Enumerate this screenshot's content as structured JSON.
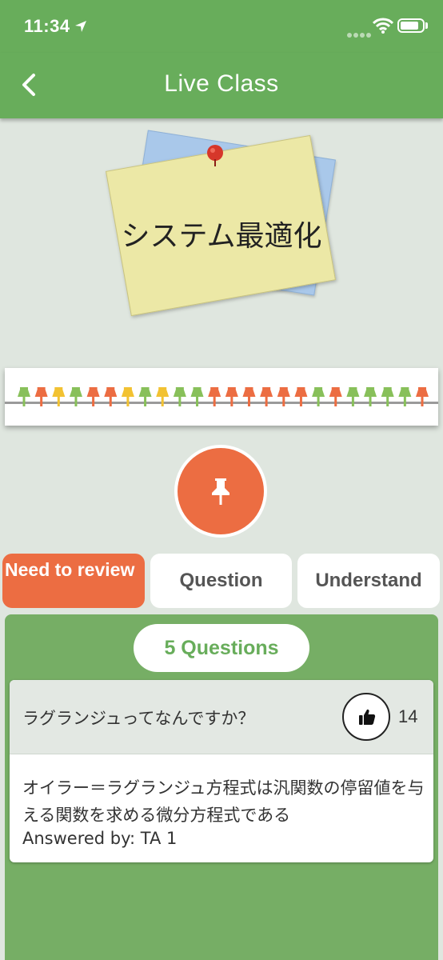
{
  "status_bar": {
    "time": "11:34",
    "icons": [
      "location-arrow-icon",
      "cellular-signal-icon",
      "wifi-icon",
      "battery-icon"
    ]
  },
  "nav": {
    "title": "Live Class",
    "back_icon": "chevron-left-icon"
  },
  "note": {
    "title": "システム最適化"
  },
  "timeline": {
    "pin_colors": {
      "need_to_review": "#ec6d42",
      "question": "#f2c232",
      "understand": "#88c05a"
    },
    "pins": [
      "understand",
      "need_to_review",
      "question",
      "understand",
      "need_to_review",
      "need_to_review",
      "question",
      "understand",
      "question",
      "understand",
      "understand",
      "need_to_review",
      "need_to_review",
      "need_to_review",
      "need_to_review",
      "need_to_review",
      "need_to_review",
      "understand",
      "need_to_review",
      "understand",
      "understand",
      "understand",
      "understand",
      "need_to_review"
    ]
  },
  "pin_button": {
    "icon": "pushpin-icon"
  },
  "categories": {
    "need_to_review": "Need to review",
    "question": "Question",
    "understand": "Understand"
  },
  "colors": {
    "accent_green": "#68ad5b",
    "accent_orange": "#ec6d42"
  },
  "questions": {
    "count_label": "5 Questions",
    "items": [
      {
        "question": "ラグランジュってなんですか？",
        "likes": "14",
        "answer": "オイラー＝ラグランジュ方程式は汎関数の停留値を与える関数を求める微分方程式である",
        "answered_by": "Answered by: TA 1"
      }
    ]
  }
}
